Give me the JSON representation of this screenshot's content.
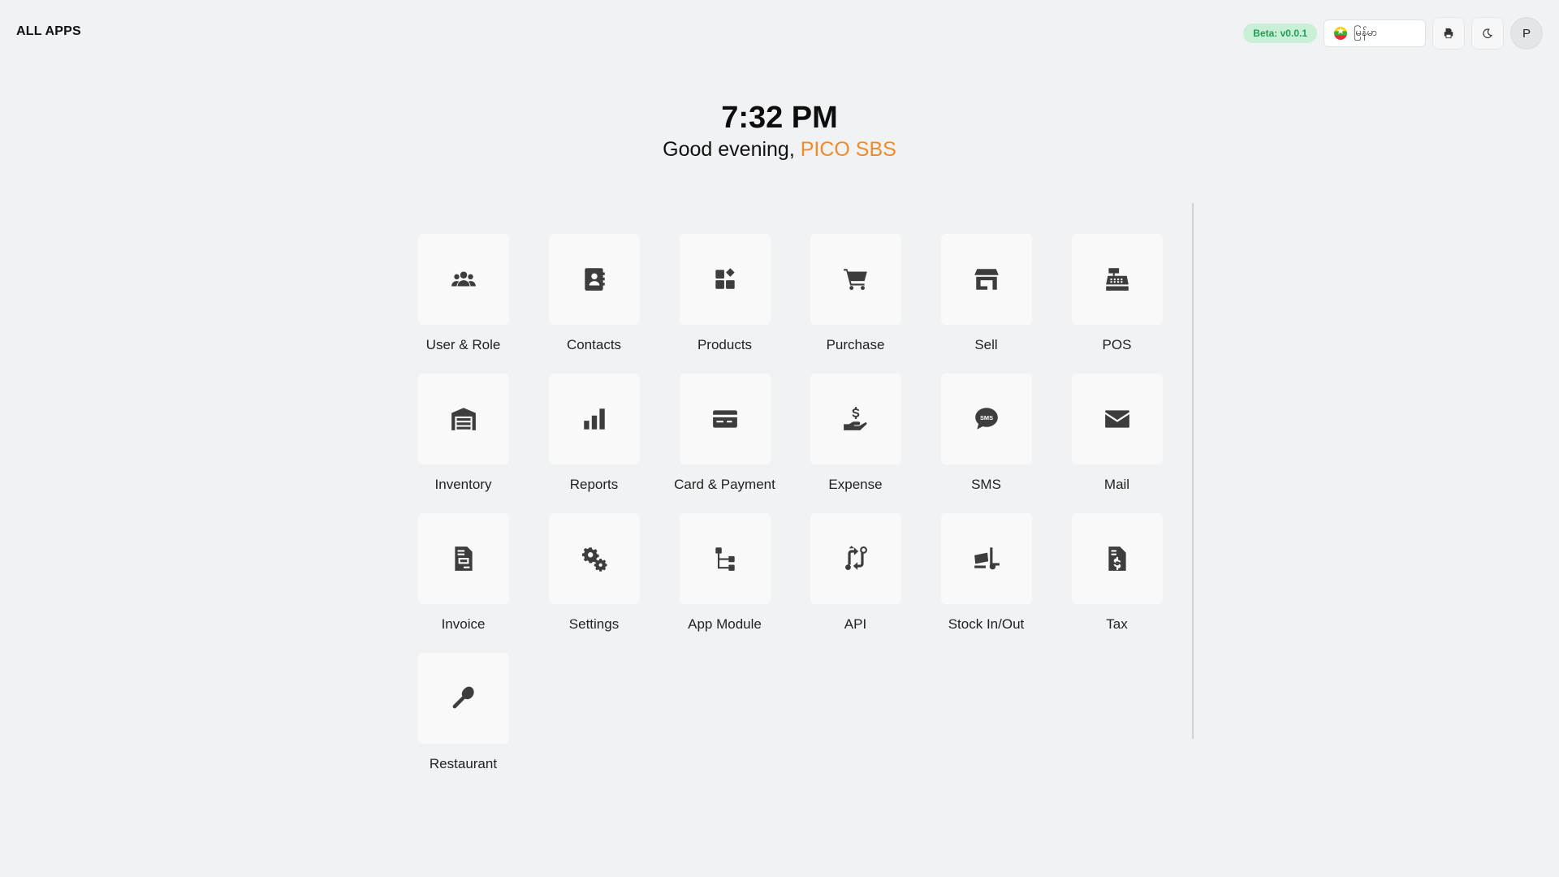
{
  "header": {
    "title": "ALL APPS",
    "version_badge": "Beta: v0.0.1",
    "language": {
      "selected": "မြန်မာ",
      "flag_icon": "myanmar-flag-icon"
    },
    "avatar_initial": "P"
  },
  "hero": {
    "time": "7:32 PM",
    "greeting": "Good evening,",
    "user_name": "PICO SBS"
  },
  "colors": {
    "accent": "#f28b26",
    "badge_bg": "#c9f0d6",
    "badge_text": "#1f9d55"
  },
  "apps": [
    {
      "label": "User & Role",
      "icon": "users-icon"
    },
    {
      "label": "Contacts",
      "icon": "contact-book-icon"
    },
    {
      "label": "Products",
      "icon": "products-icon"
    },
    {
      "label": "Purchase",
      "icon": "cart-icon"
    },
    {
      "label": "Sell",
      "icon": "store-icon"
    },
    {
      "label": "POS",
      "icon": "cash-register-icon"
    },
    {
      "label": "Inventory",
      "icon": "warehouse-icon"
    },
    {
      "label": "Reports",
      "icon": "bar-chart-icon"
    },
    {
      "label": "Card & Payment",
      "icon": "credit-card-icon"
    },
    {
      "label": "Expense",
      "icon": "hand-dollar-icon"
    },
    {
      "label": "SMS",
      "icon": "sms-icon"
    },
    {
      "label": "Mail",
      "icon": "envelope-icon"
    },
    {
      "label": "Invoice",
      "icon": "invoice-icon"
    },
    {
      "label": "Settings",
      "icon": "gears-icon"
    },
    {
      "label": "App Module",
      "icon": "module-tree-icon"
    },
    {
      "label": "API",
      "icon": "api-icon"
    },
    {
      "label": "Stock In/Out",
      "icon": "truck-ramp-icon"
    },
    {
      "label": "Tax",
      "icon": "tax-file-icon"
    },
    {
      "label": "Restaurant",
      "icon": "spoon-icon"
    }
  ]
}
